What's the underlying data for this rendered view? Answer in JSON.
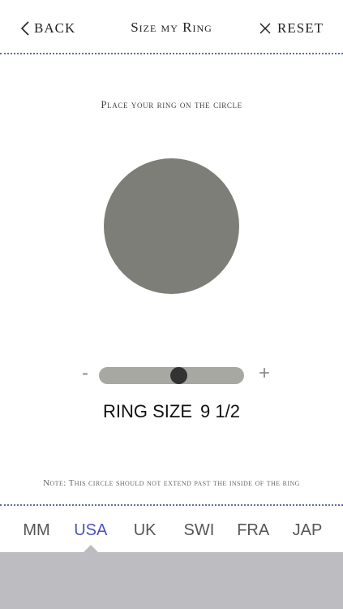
{
  "header": {
    "back_label": "BACK",
    "title": "Size my Ring",
    "reset_label": "RESET"
  },
  "main": {
    "instruction": "Place your ring on the circle",
    "circle_color": "#7d7e77",
    "slider": {
      "minus_label": "-",
      "plus_label": "+",
      "value_fraction": 0.56,
      "track_color": "#a8a8a2",
      "thumb_color": "#333333"
    },
    "ring_size": {
      "label": "RING SIZE",
      "value": "9 1/2"
    },
    "note": "Note: This circle should not extend past the inside of the ring"
  },
  "units": {
    "active_color": "#4b53b8",
    "tabs": [
      {
        "label": "MM",
        "active": false
      },
      {
        "label": "USA",
        "active": true
      },
      {
        "label": "UK",
        "active": false
      },
      {
        "label": "SWI",
        "active": false
      },
      {
        "label": "FRA",
        "active": false
      },
      {
        "label": "JAP",
        "active": false
      }
    ]
  },
  "tray_color": "#bdbcc1",
  "divider_color": "#5d6ea3"
}
